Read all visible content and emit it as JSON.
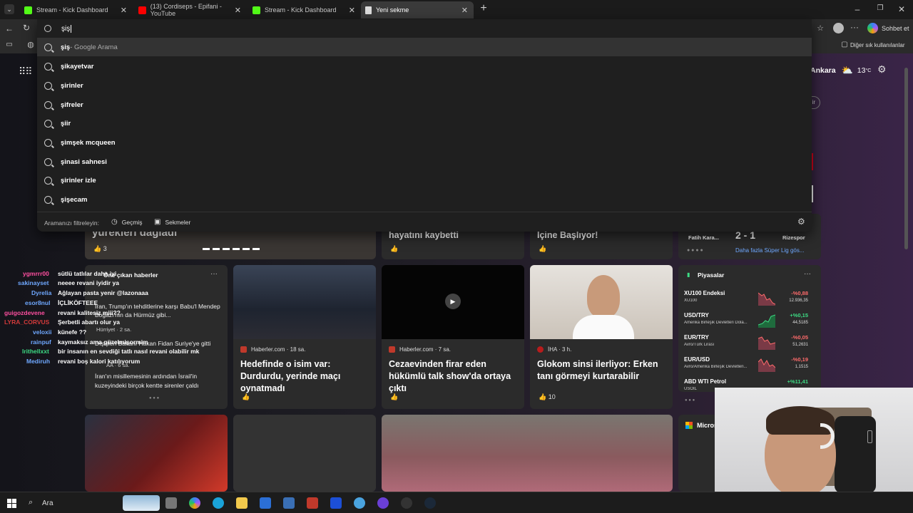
{
  "tabs": [
    {
      "label": "Stream - Kick Dashboard",
      "icon": "kick-icon",
      "color": "#53fc18"
    },
    {
      "label": "(13) Cordiseps - Epifani - YouTube",
      "icon": "youtube-icon",
      "color": "#ff0000"
    },
    {
      "label": "Stream - Kick Dashboard",
      "icon": "kick-icon",
      "color": "#53fc18"
    },
    {
      "label": "Yeni sekme",
      "icon": "newtab-icon",
      "color": "#dddddd"
    }
  ],
  "toolbar": {
    "copilot_label": "Sohbet et",
    "favorites_label": "Diğer sık kullanılanlar"
  },
  "omnibox": {
    "value": "şiş",
    "first_suggestion": "şiş",
    "first_suggestion_suffix": " - Google Arama",
    "suggestions": [
      "şikayetvar",
      "şirinler",
      "şifreler",
      "şiir",
      "şimşek mcqueen",
      "şinasi sahnesi",
      "şirinler izle",
      "şişecam"
    ],
    "filter_label": "Aramanızı filtreleyin:",
    "filter_history": "Geçmiş",
    "filter_tabs": "Sekmeler"
  },
  "weather": {
    "city": "Ankara",
    "temp": "13",
    "unit": "°C"
  },
  "news": {
    "top_row": [
      {
        "title": "yürekleri dağladı",
        "likes": "3"
      },
      {
        "title": "hayatını kaybetti"
      },
      {
        "title": "İçine Başlıyor!"
      }
    ],
    "sports": {
      "team_left": "Fatih Kara...",
      "score": "2 - 1",
      "team_right": "Rizespor",
      "more": "Daha fazla Süper Lig gös..."
    },
    "featured_label": "Öne çıkan haberler",
    "featured_items": [
      {
        "text": "İran, Trump'ın tehditlerine karşı Babu'l Mendep Boğazı'nın da Hürmüz gibi...",
        "source": "Hürriyet · 2 sa."
      },
      {
        "text": "Dışişleri Bakanı Hakan Fidan Suriye'ye gitti",
        "source": "AA · 6 sa."
      },
      {
        "text": "İran'ın misillemesinin ardından İsrail'in kuzeyindeki birçok kentte sirenler çaldı"
      }
    ],
    "cards": [
      {
        "source": "Haberler.com · 18 sa.",
        "title": "Hedefinde o isim var: Durdurdu, yerinde maçı oynatmadı",
        "likes": ""
      },
      {
        "source": "Haberler.com · 7 sa.",
        "title": "Cezaevinden firar eden hükümlü talk show'da ortaya çıktı",
        "likes": ""
      },
      {
        "source": "İHA · 3 h.",
        "title": "Glokom sinsi ilerliyor: Erken tanı görmeyi kurtarabilir",
        "likes": "10"
      }
    ]
  },
  "markets": {
    "title": "Piyasalar",
    "items": [
      {
        "name": "XU100 Endeksi",
        "sub": "XU100",
        "change": "-%0,88",
        "value": "12.936,35",
        "color": "#ff6b6b"
      },
      {
        "name": "USD/TRY",
        "sub": "Amerika Birleşik Devletleri Dola...",
        "change": "+%0,15",
        "value": "44,5185",
        "color": "#3ddc84"
      },
      {
        "name": "EUR/TRY",
        "sub": "Avro/Türk Lirası",
        "change": "-%0,05",
        "value": "51,2631",
        "color": "#ff6b6b"
      },
      {
        "name": "EUR/USD",
        "sub": "Avro/Amerika Birleşik Devletleri...",
        "change": "-%0,19",
        "value": "1,1515",
        "color": "#ff6b6b"
      },
      {
        "name": "ABD WTI Petrol",
        "sub": "USOIL",
        "change": "+%11,41",
        "value": "",
        "color": "#3ddc84"
      }
    ]
  },
  "micro_label": "Micros",
  "chat": [
    {
      "user": "ygmrrr00",
      "msg": "sütlü tatlılar daha iyi",
      "color": "#ff4fa0"
    },
    {
      "user": "sakinayset",
      "msg": "neeee revani iyidir ya",
      "color": "#6fa8ff"
    },
    {
      "user": "Dyrelia",
      "msg": "Ağlayan pasta yenir @lazonaaa",
      "color": "#6fa8ff"
    },
    {
      "user": "esor8nul",
      "msg": "İÇLİKÖFTEEE",
      "color": "#6fa8ff"
    },
    {
      "user": "guigozdevene",
      "msg": "revani kalitesiz miii??",
      "color": "#ff4fa0"
    },
    {
      "user": "LYRA_CORVUS",
      "msg": "Şerbetli abartı olur ya",
      "color": "#d23a3a"
    },
    {
      "user": "veloxii",
      "msg": "künefe ??",
      "color": "#6fa8ff"
    },
    {
      "user": "rainpuf",
      "msg": "kaymaksız ama güzelmişormim",
      "color": "#6fa8ff"
    },
    {
      "user": "lrithellxxt",
      "msg": "bir insanın en sevdiği tatlı nasıl revani olabilir mk",
      "color": "#3ddc84"
    },
    {
      "user": "Mediruh",
      "msg": "revani boş kalori katılıyorum",
      "color": "#6fa8ff"
    }
  ],
  "taskbar": {
    "search_label": "Ara"
  }
}
